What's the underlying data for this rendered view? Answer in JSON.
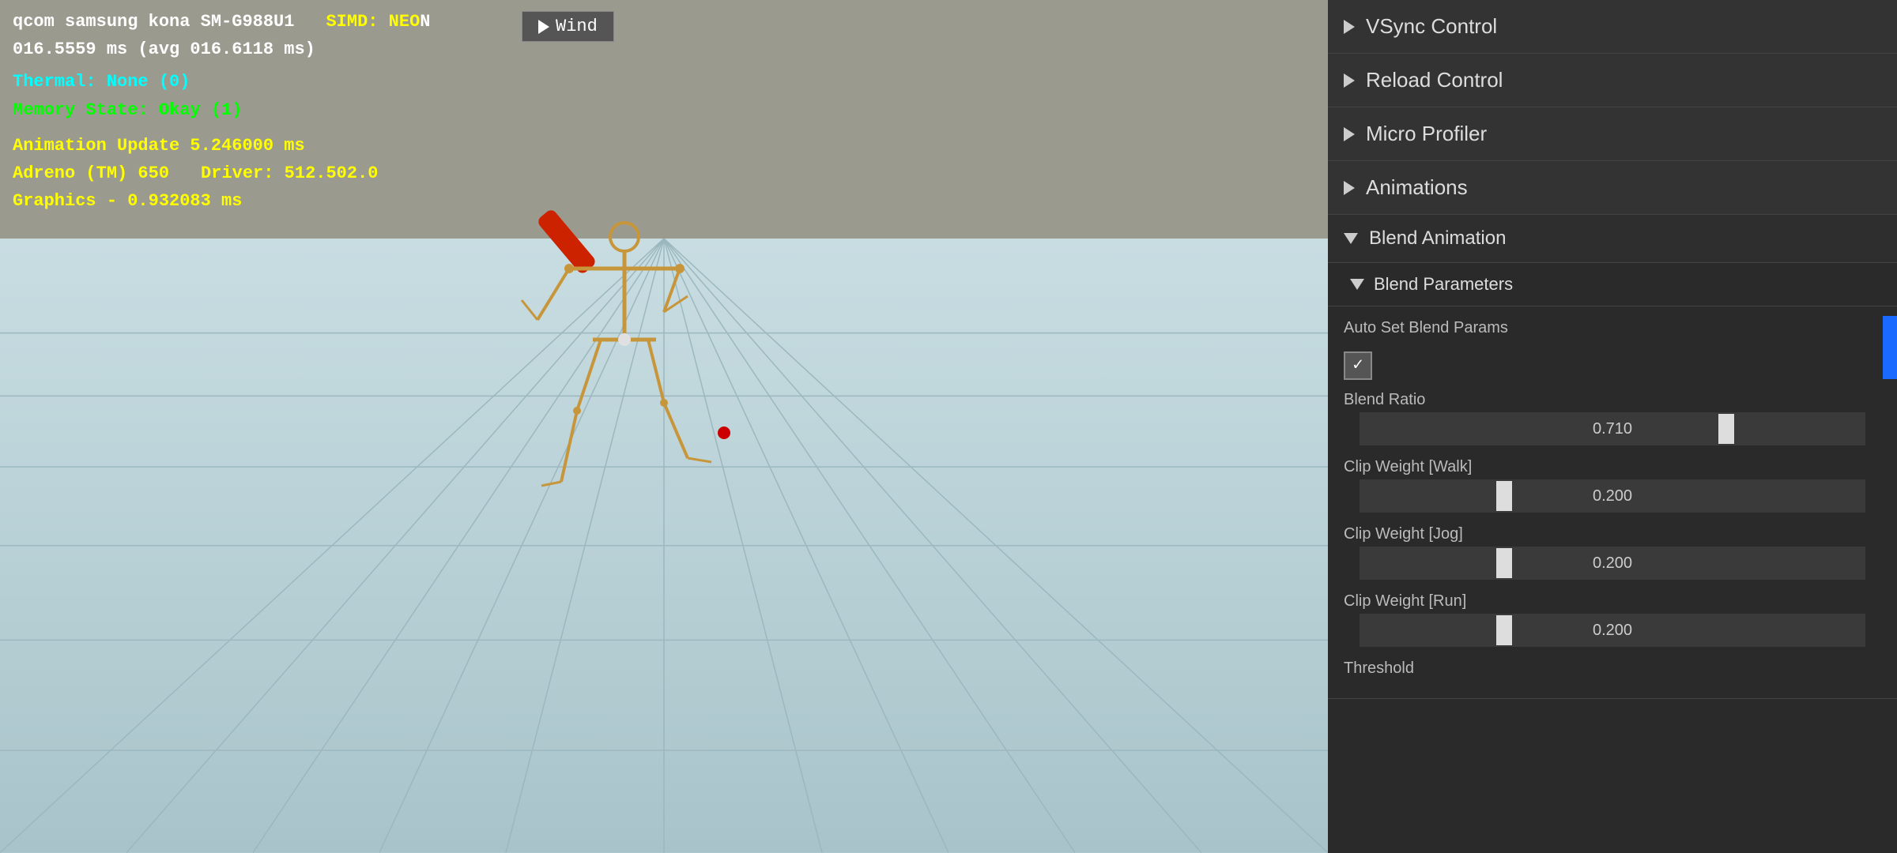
{
  "hud": {
    "line1_white": "qcom samsung kona SM-G988U1",
    "line1_simd_label": "SIMD: NEO",
    "line1_simd_suffix": "N",
    "line2": "016.5559 ms (avg 016.6118 ms)",
    "line3": "Thermal: None (0)",
    "line4": "Memory State: Okay (1)",
    "line5": "Animation Update 5.246000 ms",
    "line6a": "Adreno (TM) 650",
    "line6b": "Driver: 512.502.0",
    "line7": "Graphics - 0.932083 ms"
  },
  "wind_button": {
    "label": "Wind"
  },
  "panel": {
    "sections": [
      {
        "id": "vsync",
        "label": "VSync Control",
        "expanded": false,
        "icon": "triangle-right"
      },
      {
        "id": "reload",
        "label": "Reload Control",
        "expanded": false,
        "icon": "triangle-right"
      },
      {
        "id": "micro-profiler",
        "label": "Micro Profiler",
        "expanded": false,
        "icon": "triangle-right"
      },
      {
        "id": "animations",
        "label": "Animations",
        "expanded": false,
        "icon": "triangle-right"
      },
      {
        "id": "blend-animation",
        "label": "Blend Animation",
        "expanded": true,
        "icon": "triangle-down"
      }
    ],
    "blend_params": {
      "header": "Blend Parameters",
      "auto_set_label": "Auto Set Blend Params",
      "checked": true,
      "blend_ratio_label": "Blend Ratio",
      "blend_ratio_value": "0.710",
      "blend_ratio_pct": 71,
      "clip_walk_label": "Clip Weight [Walk]",
      "clip_walk_value": "0.200",
      "clip_walk_pct": 27,
      "clip_jog_label": "Clip Weight [Jog]",
      "clip_jog_value": "0.200",
      "clip_jog_pct": 27,
      "clip_run_label": "Clip Weight [Run]",
      "clip_run_value": "0.200",
      "clip_run_pct": 27,
      "threshold_label": "Threshold"
    }
  }
}
